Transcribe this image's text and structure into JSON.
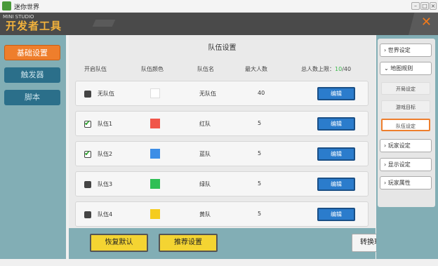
{
  "window": {
    "title": "迷你世界",
    "watermark": "MINI STUDIO",
    "controls": [
      "–",
      "□",
      "×"
    ]
  },
  "header": {
    "title": "开发者工具",
    "close_icon": "close-icon"
  },
  "left_nav": {
    "items": [
      {
        "label": "基础设置",
        "active": true
      },
      {
        "label": "触发器",
        "active": false
      },
      {
        "label": "脚本",
        "active": false
      }
    ]
  },
  "panel": {
    "title": "队伍设置",
    "columns": [
      "开启队伍",
      "队伍颜色",
      "队伍名",
      "最大人数",
      "总人数上限："
    ],
    "total_limit": {
      "current": "10",
      "max": "/40"
    },
    "rows": [
      {
        "enabled": false,
        "team": "无队伍",
        "color": "#ffffff",
        "name": "无队伍",
        "max": "40",
        "edit": "编辑"
      },
      {
        "enabled": true,
        "team": "队伍1",
        "color": "#f0564a",
        "name": "红队",
        "max": "5",
        "edit": "编辑"
      },
      {
        "enabled": true,
        "team": "队伍2",
        "color": "#3d8ee6",
        "name": "蓝队",
        "max": "5",
        "edit": "编辑"
      },
      {
        "enabled": false,
        "team": "队伍3",
        "color": "#2fbf55",
        "name": "绿队",
        "max": "5",
        "edit": "编辑"
      },
      {
        "enabled": false,
        "team": "队伍4",
        "color": "#f5cc1f",
        "name": "黄队",
        "max": "5",
        "edit": "编辑"
      }
    ]
  },
  "bottom": {
    "restore_label": "恢复默认",
    "recommend_label": "推荐设置",
    "convert_label": "转换玩法地图"
  },
  "right_nav": {
    "world_settings": "世界设定",
    "map_rules": "地图规则",
    "sub_items": [
      "开局设定",
      "游戏目标",
      "队伍设定"
    ],
    "player_settings": "玩家设定",
    "display_settings": "显示设定",
    "player_attributes": "玩家属性"
  },
  "colors": {
    "accent_orange": "#f27a1a",
    "header_title": "#f2b23c",
    "nav_active": "#ee7e2c",
    "nav_inactive": "#2b6f8a",
    "edit_button": "#2b7ccc",
    "yellow_button": "#f4d432",
    "teal_bg": "#82aeb5",
    "limit_green": "#3ab94a"
  }
}
